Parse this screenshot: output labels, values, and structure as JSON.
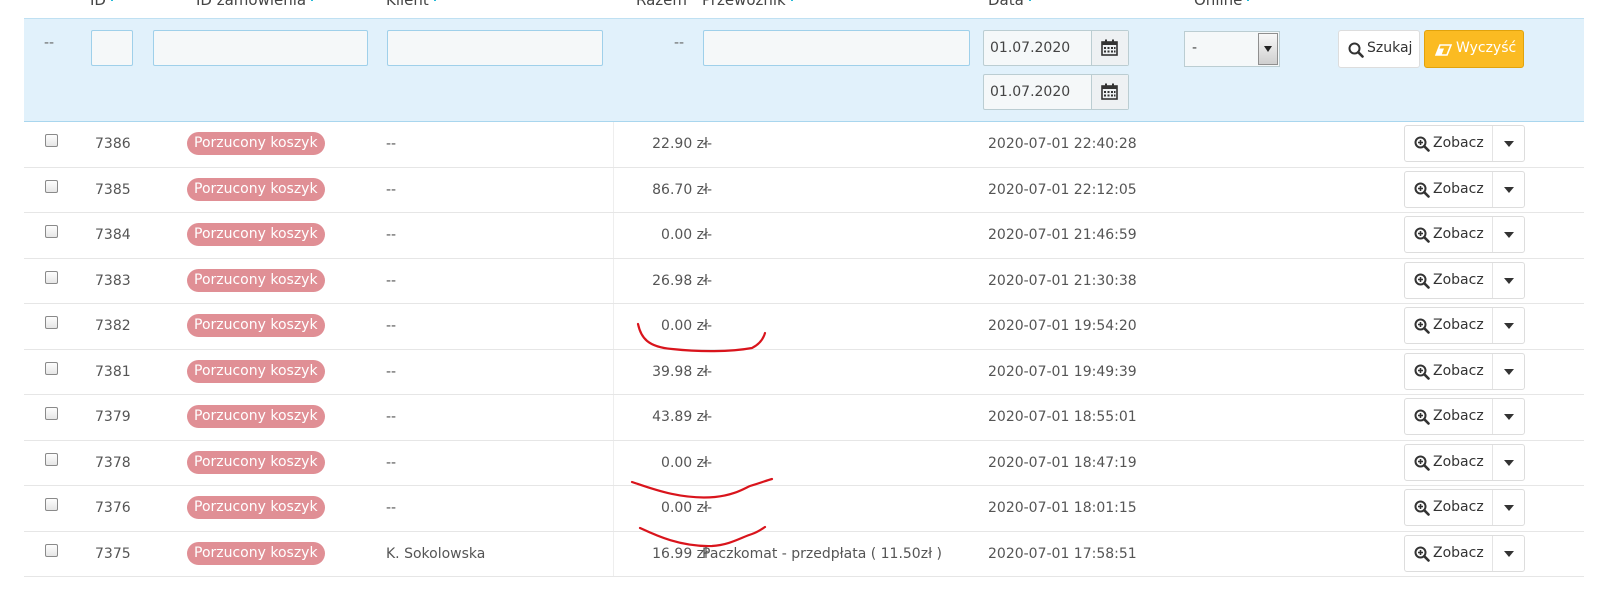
{
  "columns": {
    "id": "ID",
    "order_id": "ID zamówienia",
    "client": "Klient",
    "total": "Razem",
    "carrier": "Przewoźnik",
    "date": "Data",
    "online": "Online"
  },
  "filters": {
    "dash_left": "--",
    "dash_total": "--",
    "date_from": "01.07.2020",
    "date_to": "01.07.2020",
    "online_selected": "-",
    "search_label": "Szukaj",
    "clear_label": "Wyczyść"
  },
  "colors": {
    "filter_bg": "#e1f1fb",
    "badge": "#e08f95",
    "clear_button": "#fbbb22",
    "annotation": "#d9141c",
    "sort_accent": "#25b9d7"
  },
  "icons": {
    "calendar": "calendar-icon",
    "search": "search-icon",
    "eraser": "eraser-icon",
    "zoom": "zoom-in-icon",
    "caret": "caret-down-icon"
  },
  "view_label": "Zobacz",
  "rows": [
    {
      "id": "7386",
      "status": "Porzucony koszyk",
      "client": "--",
      "total": "22.90 zł",
      "carrier": "--",
      "date": "2020-07-01 22:40:28"
    },
    {
      "id": "7385",
      "status": "Porzucony koszyk",
      "client": "--",
      "total": "86.70 zł",
      "carrier": "--",
      "date": "2020-07-01 22:12:05"
    },
    {
      "id": "7384",
      "status": "Porzucony koszyk",
      "client": "--",
      "total": "0.00 zł",
      "carrier": "--",
      "date": "2020-07-01 21:46:59"
    },
    {
      "id": "7383",
      "status": "Porzucony koszyk",
      "client": "--",
      "total": "26.98 zł",
      "carrier": "--",
      "date": "2020-07-01 21:30:38"
    },
    {
      "id": "7382",
      "status": "Porzucony koszyk",
      "client": "--",
      "total": "0.00 zł",
      "carrier": "--",
      "date": "2020-07-01 19:54:20"
    },
    {
      "id": "7381",
      "status": "Porzucony koszyk",
      "client": "--",
      "total": "39.98 zł",
      "carrier": "--",
      "date": "2020-07-01 19:49:39"
    },
    {
      "id": "7379",
      "status": "Porzucony koszyk",
      "client": "--",
      "total": "43.89 zł",
      "carrier": "--",
      "date": "2020-07-01 18:55:01"
    },
    {
      "id": "7378",
      "status": "Porzucony koszyk",
      "client": "--",
      "total": "0.00 zł",
      "carrier": "--",
      "date": "2020-07-01 18:47:19"
    },
    {
      "id": "7376",
      "status": "Porzucony koszyk",
      "client": "--",
      "total": "0.00 zł",
      "carrier": "--",
      "date": "2020-07-01 18:01:15"
    },
    {
      "id": "7375",
      "status": "Porzucony koszyk",
      "client": "K. Sokolowska",
      "total": "16.99 zł",
      "carrier": "Paczkomat - przedpłata ( 11.50zł )",
      "date": "2020-07-01 17:58:51"
    }
  ]
}
